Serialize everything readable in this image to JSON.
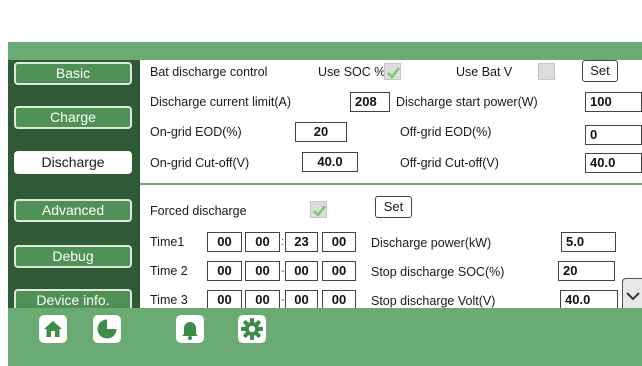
{
  "sidebar": {
    "items": [
      {
        "label": "Basic",
        "active": false
      },
      {
        "label": "Charge",
        "active": false
      },
      {
        "label": "Discharge",
        "active": true
      },
      {
        "label": "Advanced",
        "active": false
      },
      {
        "label": "Debug",
        "active": false
      },
      {
        "label": "Device info.",
        "active": false
      }
    ]
  },
  "discharge": {
    "bat_control_label": "Bat discharge control",
    "use_soc_label": "Use SOC %",
    "use_soc_checked": true,
    "use_batv_label": "Use Bat V",
    "use_batv_checked": false,
    "set_label": "Set",
    "current_limit_label": "Discharge current limit(A)",
    "current_limit_value": "208",
    "start_power_label": "Discharge start power(W)",
    "start_power_value": "100",
    "ongrid_eod_label": "On-grid EOD(%)",
    "ongrid_eod_value": "20",
    "offgrid_eod_label": "Off-grid EOD(%)",
    "offgrid_eod_value": "0",
    "ongrid_cutoff_label": "On-grid Cut-off(V)",
    "ongrid_cutoff_value": "40.0",
    "offgrid_cutoff_label": "Off-grid Cut-off(V)",
    "offgrid_cutoff_value": "40.0"
  },
  "forced": {
    "label": "Forced discharge",
    "checked": true,
    "set_label": "Set",
    "times": [
      {
        "label": "Time1",
        "values": [
          "00",
          "00",
          "23",
          "00"
        ]
      },
      {
        "label": "Time 2",
        "values": [
          "00",
          "00",
          "00",
          "00"
        ]
      },
      {
        "label": "Time 3",
        "values": [
          "00",
          "00",
          "00",
          "00"
        ]
      }
    ],
    "power_label": "Discharge power(kW)",
    "power_value": "5.0",
    "stop_soc_label": "Stop discharge SOC(%)",
    "stop_soc_value": "20",
    "stop_volt_label": "Stop discharge Volt(V)",
    "stop_volt_value": "40.0"
  },
  "bottom_nav": {
    "icons": [
      "home-icon",
      "pie-chart-icon",
      "bell-icon",
      "gear-icon"
    ],
    "active": "gear-icon"
  },
  "colors": {
    "header_green": "#6aaa73",
    "sidebar_dark_green": "#2f5a36",
    "button_green": "#4f9154",
    "check_green": "#7cc576"
  }
}
